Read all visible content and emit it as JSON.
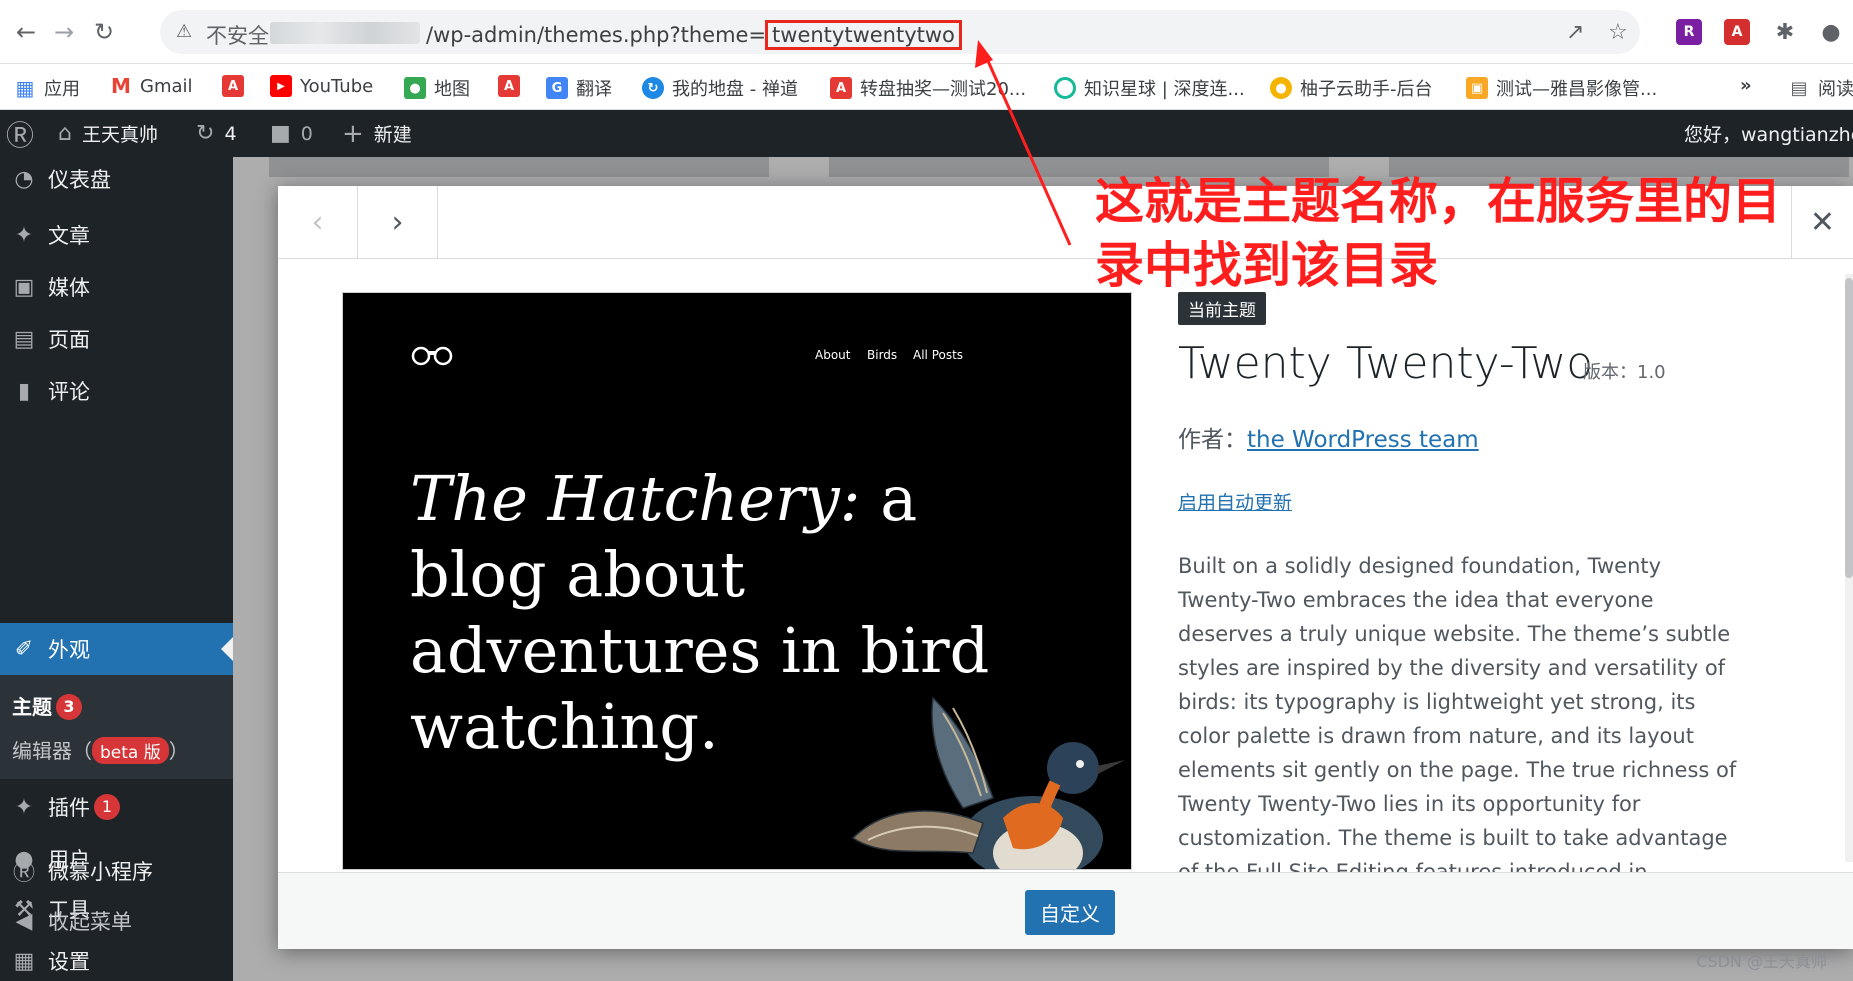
{
  "browser": {
    "insecure_label": "不安全",
    "url_prefix": "/wp-admin/themes.php?theme=",
    "url_theme": "twentytwentytwo"
  },
  "bookmarks": [
    {
      "label": "应用",
      "icon": "apps-icon",
      "color": "#ea4335"
    },
    {
      "label": "Gmail",
      "icon": "gmail-icon",
      "color": "#ea4335"
    },
    {
      "label": "",
      "icon": "acrobat-icon",
      "color": "#e53935"
    },
    {
      "label": "YouTube",
      "icon": "youtube-icon",
      "color": "#ff0000"
    },
    {
      "label": "地图",
      "icon": "maps-icon",
      "color": "#34a853"
    },
    {
      "label": "",
      "icon": "acrobat-icon",
      "color": "#e53935"
    },
    {
      "label": "翻译",
      "icon": "translate-icon",
      "color": "#4285f4"
    },
    {
      "label": "我的地盘 - 禅道",
      "icon": "zentao-icon",
      "color": "#1e88e5"
    },
    {
      "label": "转盘抽奖—测试20...",
      "icon": "acrobat-icon",
      "color": "#e53935"
    },
    {
      "label": "知识星球 | 深度连...",
      "icon": "zsxq-icon",
      "color": "#16b998"
    },
    {
      "label": "柚子云助手-后台",
      "icon": "youzi-icon",
      "color": "#f4b400"
    },
    {
      "label": "测试—雅昌影像管...",
      "icon": "yachang-icon",
      "color": "#f9a825"
    },
    {
      "label": "»",
      "icon": "more-icon",
      "color": "#5f6368"
    },
    {
      "label": "阅读",
      "icon": "reading-list-icon",
      "color": "#5f6368"
    }
  ],
  "adminbar": {
    "site_name": "王天真帅",
    "updates_count": "4",
    "comments_count": "0",
    "new_label": "新建",
    "greeting": "您好，wangtianzhe"
  },
  "sidebar": {
    "items": [
      {
        "label": "仪表盘",
        "icon": "dashboard-icon"
      },
      {
        "label": "文章",
        "icon": "pin-icon"
      },
      {
        "label": "媒体",
        "icon": "media-icon"
      },
      {
        "label": "页面",
        "icon": "pages-icon"
      },
      {
        "label": "评论",
        "icon": "comments-icon"
      },
      {
        "label": "外观",
        "icon": "appearance-icon"
      },
      {
        "label": "插件",
        "icon": "plugins-icon"
      },
      {
        "label": "用户",
        "icon": "users-icon"
      },
      {
        "label": "工具",
        "icon": "tools-icon"
      },
      {
        "label": "设置",
        "icon": "settings-icon"
      },
      {
        "label": "微慕小程序",
        "icon": "weimu-icon"
      },
      {
        "label": "收起菜单",
        "icon": "collapse-icon"
      }
    ],
    "sub_themes": "主题",
    "sub_themes_badge": "3",
    "sub_editor": "编辑器（",
    "sub_editor_beta": "beta 版",
    "sub_editor_close": "）",
    "plugins_badge": "1"
  },
  "preview": {
    "nav": [
      "About",
      "Birds",
      "All Posts"
    ],
    "headline_italic": "The Hatchery:",
    "headline_rest": " a blog about adventures in bird watching."
  },
  "theme": {
    "current_tag": "当前主题",
    "name": "Twenty Twenty-Two",
    "version_label": "版本：1.0",
    "author_label": "作者：",
    "author_link": "the WordPress team",
    "auto_update": "启用自动更新",
    "description": "Built on a solidly designed foundation, Twenty Twenty-Two embraces the idea that everyone deserves a truly unique website. The theme’s subtle styles are inspired by the diversity and versatility of birds: its typography is lightweight yet strong, its color palette is drawn from nature, and its layout elements sit gently on the page. The true richness of Twenty Twenty-Two lies in its opportunity for customization. The theme is built to take advantage of the Full Site Editing features introduced in"
  },
  "footer": {
    "customize_label": "自定义"
  },
  "annotation": {
    "text": "这就是主题名称，在服务里的目录中找到该目录",
    "color": "#ff1e1e"
  },
  "watermark": "CSDN @王天真帅",
  "colors": {
    "wp_blue": "#2271b1",
    "admin_dark": "#1d2327",
    "badge_red": "#d63638"
  }
}
